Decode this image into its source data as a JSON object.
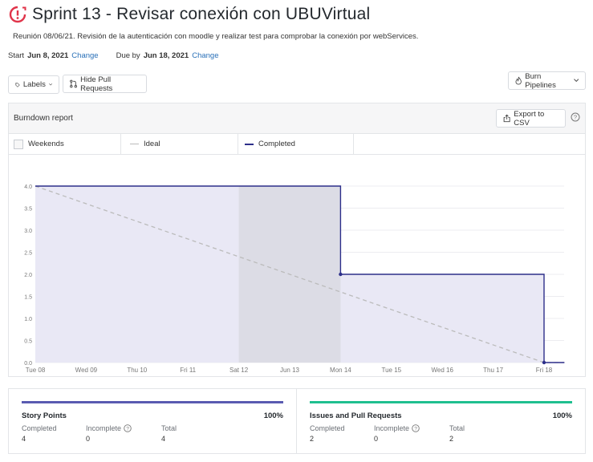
{
  "header": {
    "title": "Sprint 13 - Revisar conexión con UBUVirtual",
    "description": "Reunión 08/06/21. Revisión de la autenticación con moodle y realizar test para comprobar la conexión por webServices.",
    "start_label": "Start",
    "start_date": "Jun 8, 2021",
    "due_label": "Due by",
    "due_date": "Jun 18, 2021",
    "change_label": "Change",
    "milestone_icon": "milestone-icon"
  },
  "toolbar": {
    "labels_button": "Labels",
    "hide_pr_button": "Hide Pull Requests",
    "burn_button": "Burn Pipelines"
  },
  "report": {
    "title": "Burndown report",
    "export_button": "Export to CSV",
    "legend": {
      "weekends": "Weekends",
      "ideal": "Ideal",
      "completed": "Completed"
    }
  },
  "colors": {
    "completed_line": "#2d2f8a",
    "completed_fill": "#e9e8f5",
    "weekend_fill": "#dcdce5",
    "ideal_line": "#bbbbbb",
    "story_bar": "#5a5bb1",
    "issues_bar": "#1fbf8f"
  },
  "chart_data": {
    "type": "line",
    "x": [
      "Tue 08",
      "Wed 09",
      "Thu 10",
      "Fri 11",
      "Sat 12",
      "Jun 13",
      "Mon 14",
      "Tue 15",
      "Wed 16",
      "Thu 17",
      "Fri 18"
    ],
    "yticks": [
      "0.0",
      "0.5",
      "1.0",
      "1.5",
      "2.0",
      "2.5",
      "3.0",
      "3.5",
      "4.0"
    ],
    "ylim": [
      0,
      4
    ],
    "weekend_range": [
      "Sat 12",
      "Mon 14"
    ],
    "series": [
      {
        "name": "Ideal",
        "x": [
          0,
          10,
          10.4
        ],
        "values": [
          4,
          0,
          0
        ]
      },
      {
        "name": "Completed",
        "x": [
          0,
          6,
          6,
          10,
          10,
          10.4
        ],
        "values": [
          4,
          4,
          2,
          2,
          0,
          0
        ]
      }
    ]
  },
  "stats": {
    "story": {
      "title": "Story Points",
      "percent": "100%",
      "percent_value": 100,
      "completed_label": "Completed",
      "completed": "4",
      "incomplete_label": "Incomplete",
      "incomplete": "0",
      "total_label": "Total",
      "total": "4"
    },
    "issues": {
      "title": "Issues and Pull Requests",
      "percent": "100%",
      "percent_value": 100,
      "completed_label": "Completed",
      "completed": "2",
      "incomplete_label": "Incomplete",
      "incomplete": "0",
      "total_label": "Total",
      "total": "2"
    }
  }
}
